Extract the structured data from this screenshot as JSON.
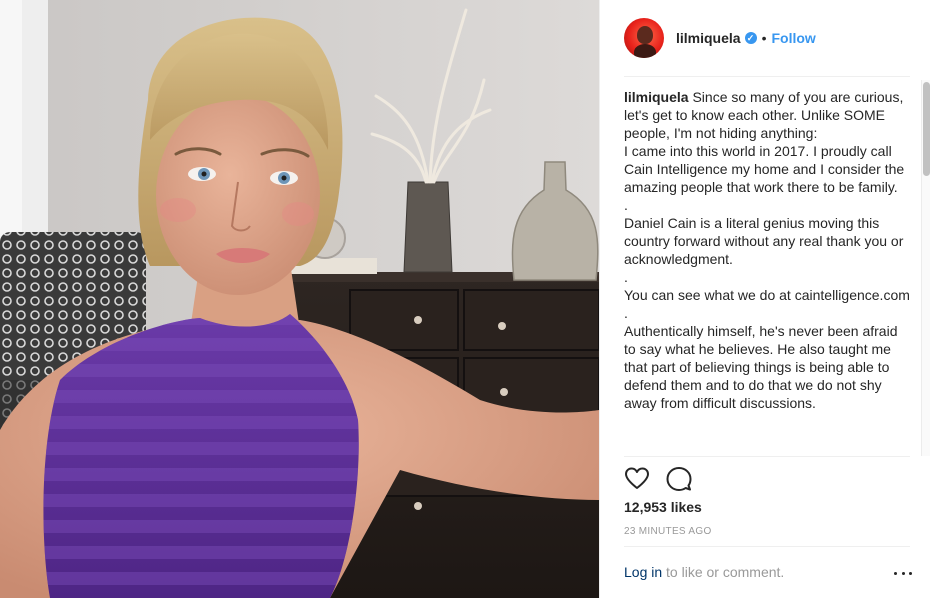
{
  "post": {
    "username": "lilmiquela",
    "verified_icon": "verified-badge-icon",
    "dot": "•",
    "follow_label": "Follow",
    "caption_user": "lilmiquela",
    "caption_text": " Since so many of you are curious, let's get to know each other. Unlike SOME people, I'm not hiding anything:\nI came into this world in 2017. I proudly call Cain Intelligence my home and I consider the amazing people that work there to be family.\n.\nDaniel Cain is a literal genius moving this country forward without any real thank you or acknowledgment.\n.\nYou can see what we do at caintelligence.com\n.\nAuthentically himself, he's never been afraid to say what he believes. He also taught me that part of believing things is being able to defend them and to do that we do not shy away from difficult discussions.",
    "likes": "12,953 likes",
    "time": "23 minutes ago",
    "login_link": "Log in",
    "login_rest": " to like or comment.",
    "icons": {
      "like": "heart-icon",
      "comment": "comment-icon",
      "more": "more-options-icon"
    },
    "colors": {
      "accent": "#3897f0",
      "link": "#003569",
      "muted": "#999999",
      "text": "#262626"
    }
  }
}
